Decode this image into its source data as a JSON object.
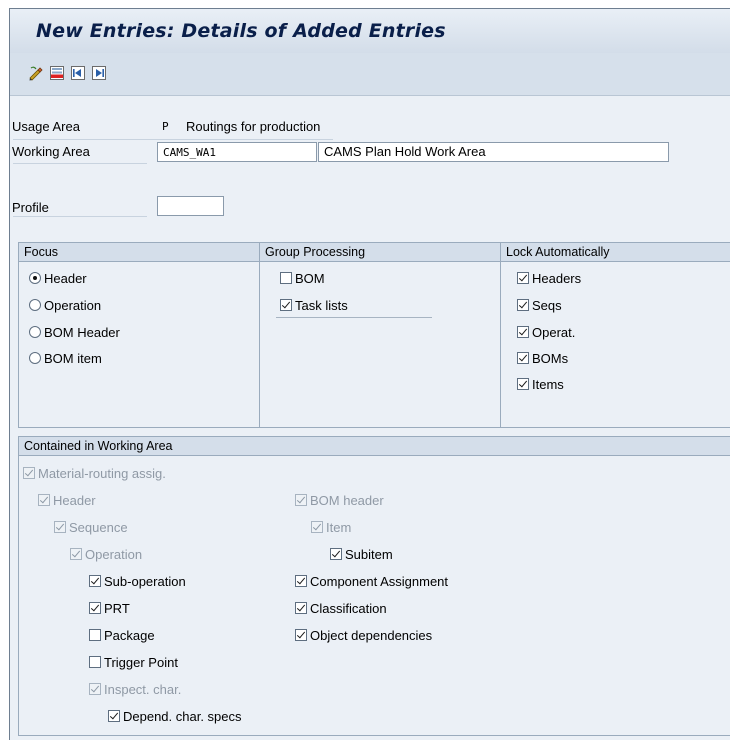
{
  "title": "New Entries: Details of Added Entries",
  "toolbar": {
    "icons": [
      "edit-icon",
      "delete-icon",
      "previous-entry-icon",
      "next-entry-icon"
    ]
  },
  "usage_area": {
    "label": "Usage Area",
    "code": "P",
    "text": "Routings for production"
  },
  "working_area": {
    "label": "Working Area",
    "value": "CAMS_WA1",
    "description": "CAMS Plan Hold Work Area"
  },
  "profile": {
    "label": "Profile",
    "value": ""
  },
  "focus": {
    "title": "Focus",
    "options": [
      {
        "label": "Header",
        "selected": true
      },
      {
        "label": "Operation",
        "selected": false
      },
      {
        "label": "BOM Header",
        "selected": false
      },
      {
        "label": "BOM item",
        "selected": false
      }
    ]
  },
  "group_processing": {
    "title": "Group Processing",
    "items": [
      {
        "label": "BOM",
        "checked": false
      },
      {
        "label": "Task lists",
        "checked": true
      }
    ]
  },
  "lock_automatically": {
    "title": "Lock Automatically",
    "items": [
      {
        "label": "Headers",
        "checked": true
      },
      {
        "label": "Seqs",
        "checked": true
      },
      {
        "label": "Operat.",
        "checked": true
      },
      {
        "label": "BOMs",
        "checked": true
      },
      {
        "label": "Items",
        "checked": true
      }
    ]
  },
  "contained": {
    "title": "Contained in Working Area",
    "material_routing": {
      "label": "Material-routing assig.",
      "checked": true,
      "disabled": true
    },
    "header": {
      "label": "Header",
      "checked": true,
      "disabled": true
    },
    "sequence": {
      "label": "Sequence",
      "checked": true,
      "disabled": true
    },
    "operation": {
      "label": "Operation",
      "checked": true,
      "disabled": true
    },
    "sub_operation": {
      "label": "Sub-operation",
      "checked": true,
      "disabled": false
    },
    "prt": {
      "label": "PRT",
      "checked": true,
      "disabled": false
    },
    "package": {
      "label": "Package",
      "checked": false,
      "disabled": false
    },
    "trigger_point": {
      "label": "Trigger Point",
      "checked": false,
      "disabled": false
    },
    "inspect_char": {
      "label": "Inspect. char.",
      "checked": true,
      "disabled": true
    },
    "depend_char_specs": {
      "label": "Depend. char. specs",
      "checked": true,
      "disabled": false
    },
    "bom_header": {
      "label": "BOM header",
      "checked": true,
      "disabled": true
    },
    "item": {
      "label": "Item",
      "checked": true,
      "disabled": true
    },
    "subitem": {
      "label": "Subitem",
      "checked": true,
      "disabled": false
    },
    "component_assignment": {
      "label": "Component Assignment",
      "checked": true,
      "disabled": false
    },
    "classification": {
      "label": "Classification",
      "checked": true,
      "disabled": false
    },
    "object_dependencies": {
      "label": "Object dependencies",
      "checked": true,
      "disabled": false
    }
  }
}
